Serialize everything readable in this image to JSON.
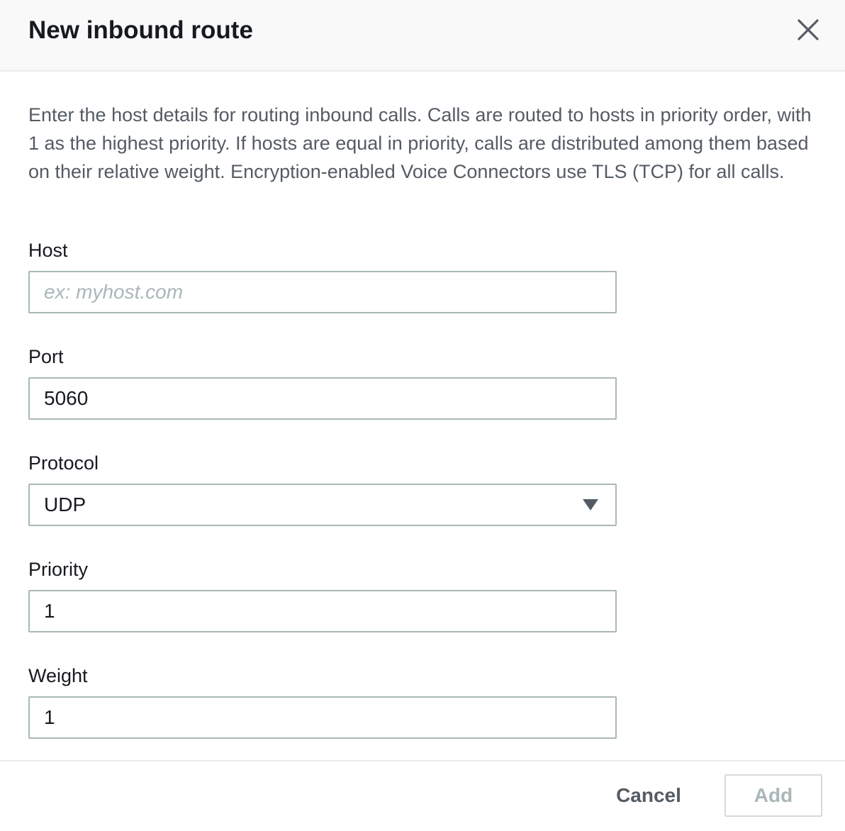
{
  "modal": {
    "title": "New inbound route",
    "description": "Enter the host details for routing inbound calls. Calls are routed to hosts in priority order, with 1 as the highest priority. If hosts are equal in priority, calls are distributed among them based on their relative weight. Encryption-enabled Voice Connectors use TLS (TCP) for all calls."
  },
  "fields": {
    "host": {
      "label": "Host",
      "value": "",
      "placeholder": "ex: myhost.com"
    },
    "port": {
      "label": "Port",
      "value": "5060"
    },
    "protocol": {
      "label": "Protocol",
      "selected": "UDP"
    },
    "priority": {
      "label": "Priority",
      "value": "1"
    },
    "weight": {
      "label": "Weight",
      "value": "1"
    }
  },
  "footer": {
    "cancel_label": "Cancel",
    "add_label": "Add"
  },
  "icons": {
    "close": "close-icon",
    "dropdown": "caret-down-icon"
  },
  "colors": {
    "header_bg": "#f9f9f9",
    "text_primary": "#16191f",
    "text_secondary": "#545b64",
    "border": "#aab7b8",
    "disabled": "#aab7b8"
  }
}
